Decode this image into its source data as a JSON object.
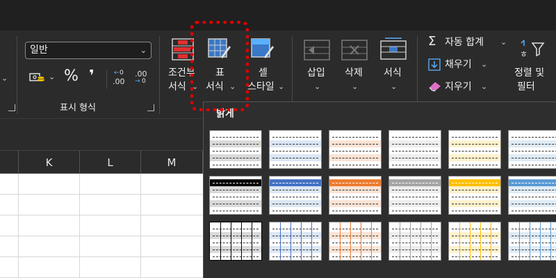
{
  "ribbon": {
    "number_group": {
      "format_value": "일반",
      "group_label": "표시 형식",
      "percent_symbol": "%",
      "comma_symbol": "❜",
      "inc_decimal": ".00",
      "dec_decimal": ".00"
    },
    "styles_group": {
      "conditional_line1": "조건부",
      "conditional_line2": "서식",
      "table_line1": "표",
      "table_line2": "서식",
      "cell_line1": "셀",
      "cell_line2": "스타일"
    },
    "cells_group": {
      "insert": "삽입",
      "delete": "삭제",
      "format": "서식"
    },
    "editing_group": {
      "autosum": "자동 합계",
      "fill": "채우기",
      "clear": "지우기",
      "sort_line1": "정렬 및",
      "sort_line2": "필터"
    }
  },
  "columns": [
    "K",
    "L",
    "M"
  ],
  "dropdown": {
    "section_label": "밝게"
  },
  "colors": {
    "accent_red": "#e00000",
    "ribbon_bg": "#2b2b2b",
    "dropdown_bg": "#2e2e2e"
  }
}
